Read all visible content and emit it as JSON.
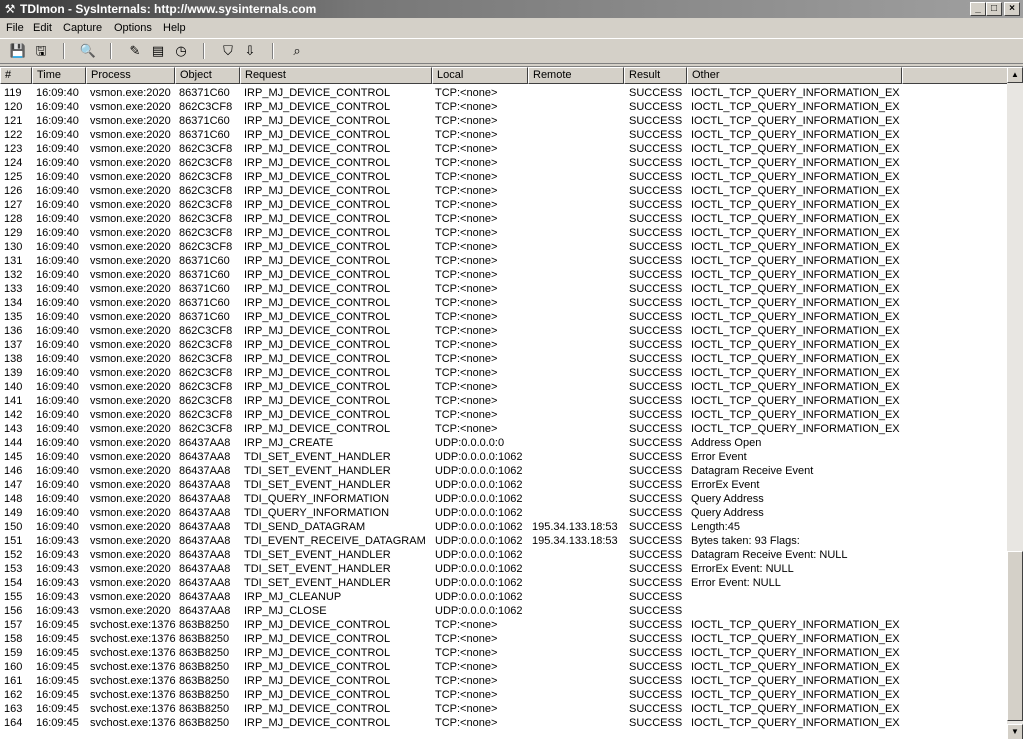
{
  "window": {
    "title": "TDImon - SysInternals: http://www.sysinternals.com",
    "app_icon": "tdimon-icon",
    "minimize": "_",
    "maximize": "□",
    "close": "×"
  },
  "menu": [
    "File",
    "Edit",
    "Capture",
    "Options",
    "Help"
  ],
  "toolbar": {
    "buttons": [
      {
        "name": "save-icon",
        "glyph": "💾"
      },
      {
        "name": "save-as-icon",
        "glyph": "🖫"
      },
      {
        "name": "find-icon",
        "glyph": "🔍"
      },
      {
        "name": "capture-icon",
        "glyph": "✎"
      },
      {
        "name": "autoscroll-icon",
        "glyph": "▤"
      },
      {
        "name": "clock-icon",
        "glyph": "◷"
      },
      {
        "name": "filter-icon",
        "glyph": "⛉"
      },
      {
        "name": "highlight-icon",
        "glyph": "⇩"
      },
      {
        "name": "binoculars-icon",
        "glyph": "⌕"
      }
    ]
  },
  "columns": [
    "#",
    "Time",
    "Process",
    "Object",
    "Request",
    "Local",
    "Remote",
    "Result",
    "Other"
  ],
  "rows": [
    [
      "119",
      "16:09:40",
      "vsmon.exe:2020",
      "86371C60",
      "IRP_MJ_DEVICE_CONTROL",
      "TCP:<none>",
      "",
      "SUCCESS",
      "IOCTL_TCP_QUERY_INFORMATION_EX"
    ],
    [
      "120",
      "16:09:40",
      "vsmon.exe:2020",
      "862C3CF8",
      "IRP_MJ_DEVICE_CONTROL",
      "TCP:<none>",
      "",
      "SUCCESS",
      "IOCTL_TCP_QUERY_INFORMATION_EX"
    ],
    [
      "121",
      "16:09:40",
      "vsmon.exe:2020",
      "86371C60",
      "IRP_MJ_DEVICE_CONTROL",
      "TCP:<none>",
      "",
      "SUCCESS",
      "IOCTL_TCP_QUERY_INFORMATION_EX"
    ],
    [
      "122",
      "16:09:40",
      "vsmon.exe:2020",
      "86371C60",
      "IRP_MJ_DEVICE_CONTROL",
      "TCP:<none>",
      "",
      "SUCCESS",
      "IOCTL_TCP_QUERY_INFORMATION_EX"
    ],
    [
      "123",
      "16:09:40",
      "vsmon.exe:2020",
      "862C3CF8",
      "IRP_MJ_DEVICE_CONTROL",
      "TCP:<none>",
      "",
      "SUCCESS",
      "IOCTL_TCP_QUERY_INFORMATION_EX"
    ],
    [
      "124",
      "16:09:40",
      "vsmon.exe:2020",
      "862C3CF8",
      "IRP_MJ_DEVICE_CONTROL",
      "TCP:<none>",
      "",
      "SUCCESS",
      "IOCTL_TCP_QUERY_INFORMATION_EX"
    ],
    [
      "125",
      "16:09:40",
      "vsmon.exe:2020",
      "862C3CF8",
      "IRP_MJ_DEVICE_CONTROL",
      "TCP:<none>",
      "",
      "SUCCESS",
      "IOCTL_TCP_QUERY_INFORMATION_EX"
    ],
    [
      "126",
      "16:09:40",
      "vsmon.exe:2020",
      "862C3CF8",
      "IRP_MJ_DEVICE_CONTROL",
      "TCP:<none>",
      "",
      "SUCCESS",
      "IOCTL_TCP_QUERY_INFORMATION_EX"
    ],
    [
      "127",
      "16:09:40",
      "vsmon.exe:2020",
      "862C3CF8",
      "IRP_MJ_DEVICE_CONTROL",
      "TCP:<none>",
      "",
      "SUCCESS",
      "IOCTL_TCP_QUERY_INFORMATION_EX"
    ],
    [
      "128",
      "16:09:40",
      "vsmon.exe:2020",
      "862C3CF8",
      "IRP_MJ_DEVICE_CONTROL",
      "TCP:<none>",
      "",
      "SUCCESS",
      "IOCTL_TCP_QUERY_INFORMATION_EX"
    ],
    [
      "129",
      "16:09:40",
      "vsmon.exe:2020",
      "862C3CF8",
      "IRP_MJ_DEVICE_CONTROL",
      "TCP:<none>",
      "",
      "SUCCESS",
      "IOCTL_TCP_QUERY_INFORMATION_EX"
    ],
    [
      "130",
      "16:09:40",
      "vsmon.exe:2020",
      "862C3CF8",
      "IRP_MJ_DEVICE_CONTROL",
      "TCP:<none>",
      "",
      "SUCCESS",
      "IOCTL_TCP_QUERY_INFORMATION_EX"
    ],
    [
      "131",
      "16:09:40",
      "vsmon.exe:2020",
      "86371C60",
      "IRP_MJ_DEVICE_CONTROL",
      "TCP:<none>",
      "",
      "SUCCESS",
      "IOCTL_TCP_QUERY_INFORMATION_EX"
    ],
    [
      "132",
      "16:09:40",
      "vsmon.exe:2020",
      "86371C60",
      "IRP_MJ_DEVICE_CONTROL",
      "TCP:<none>",
      "",
      "SUCCESS",
      "IOCTL_TCP_QUERY_INFORMATION_EX"
    ],
    [
      "133",
      "16:09:40",
      "vsmon.exe:2020",
      "86371C60",
      "IRP_MJ_DEVICE_CONTROL",
      "TCP:<none>",
      "",
      "SUCCESS",
      "IOCTL_TCP_QUERY_INFORMATION_EX"
    ],
    [
      "134",
      "16:09:40",
      "vsmon.exe:2020",
      "86371C60",
      "IRP_MJ_DEVICE_CONTROL",
      "TCP:<none>",
      "",
      "SUCCESS",
      "IOCTL_TCP_QUERY_INFORMATION_EX"
    ],
    [
      "135",
      "16:09:40",
      "vsmon.exe:2020",
      "86371C60",
      "IRP_MJ_DEVICE_CONTROL",
      "TCP:<none>",
      "",
      "SUCCESS",
      "IOCTL_TCP_QUERY_INFORMATION_EX"
    ],
    [
      "136",
      "16:09:40",
      "vsmon.exe:2020",
      "862C3CF8",
      "IRP_MJ_DEVICE_CONTROL",
      "TCP:<none>",
      "",
      "SUCCESS",
      "IOCTL_TCP_QUERY_INFORMATION_EX"
    ],
    [
      "137",
      "16:09:40",
      "vsmon.exe:2020",
      "862C3CF8",
      "IRP_MJ_DEVICE_CONTROL",
      "TCP:<none>",
      "",
      "SUCCESS",
      "IOCTL_TCP_QUERY_INFORMATION_EX"
    ],
    [
      "138",
      "16:09:40",
      "vsmon.exe:2020",
      "862C3CF8",
      "IRP_MJ_DEVICE_CONTROL",
      "TCP:<none>",
      "",
      "SUCCESS",
      "IOCTL_TCP_QUERY_INFORMATION_EX"
    ],
    [
      "139",
      "16:09:40",
      "vsmon.exe:2020",
      "862C3CF8",
      "IRP_MJ_DEVICE_CONTROL",
      "TCP:<none>",
      "",
      "SUCCESS",
      "IOCTL_TCP_QUERY_INFORMATION_EX"
    ],
    [
      "140",
      "16:09:40",
      "vsmon.exe:2020",
      "862C3CF8",
      "IRP_MJ_DEVICE_CONTROL",
      "TCP:<none>",
      "",
      "SUCCESS",
      "IOCTL_TCP_QUERY_INFORMATION_EX"
    ],
    [
      "141",
      "16:09:40",
      "vsmon.exe:2020",
      "862C3CF8",
      "IRP_MJ_DEVICE_CONTROL",
      "TCP:<none>",
      "",
      "SUCCESS",
      "IOCTL_TCP_QUERY_INFORMATION_EX"
    ],
    [
      "142",
      "16:09:40",
      "vsmon.exe:2020",
      "862C3CF8",
      "IRP_MJ_DEVICE_CONTROL",
      "TCP:<none>",
      "",
      "SUCCESS",
      "IOCTL_TCP_QUERY_INFORMATION_EX"
    ],
    [
      "143",
      "16:09:40",
      "vsmon.exe:2020",
      "862C3CF8",
      "IRP_MJ_DEVICE_CONTROL",
      "TCP:<none>",
      "",
      "SUCCESS",
      "IOCTL_TCP_QUERY_INFORMATION_EX"
    ],
    [
      "144",
      "16:09:40",
      "vsmon.exe:2020",
      "86437AA8",
      "IRP_MJ_CREATE",
      "UDP:0.0.0.0:0",
      "",
      "SUCCESS",
      "Address Open"
    ],
    [
      "145",
      "16:09:40",
      "vsmon.exe:2020",
      "86437AA8",
      "TDI_SET_EVENT_HANDLER",
      "UDP:0.0.0.0:1062",
      "",
      "SUCCESS",
      "Error Event"
    ],
    [
      "146",
      "16:09:40",
      "vsmon.exe:2020",
      "86437AA8",
      "TDI_SET_EVENT_HANDLER",
      "UDP:0.0.0.0:1062",
      "",
      "SUCCESS",
      "Datagram Receive Event"
    ],
    [
      "147",
      "16:09:40",
      "vsmon.exe:2020",
      "86437AA8",
      "TDI_SET_EVENT_HANDLER",
      "UDP:0.0.0.0:1062",
      "",
      "SUCCESS",
      "ErrorEx Event"
    ],
    [
      "148",
      "16:09:40",
      "vsmon.exe:2020",
      "86437AA8",
      "TDI_QUERY_INFORMATION",
      "UDP:0.0.0.0:1062",
      "",
      "SUCCESS",
      "Query Address"
    ],
    [
      "149",
      "16:09:40",
      "vsmon.exe:2020",
      "86437AA8",
      "TDI_QUERY_INFORMATION",
      "UDP:0.0.0.0:1062",
      "",
      "SUCCESS",
      "Query Address"
    ],
    [
      "150",
      "16:09:40",
      "vsmon.exe:2020",
      "86437AA8",
      "TDI_SEND_DATAGRAM",
      "UDP:0.0.0.0:1062",
      "195.34.133.18:53",
      "SUCCESS",
      "Length:45"
    ],
    [
      "151",
      "16:09:43",
      "vsmon.exe:2020",
      "86437AA8",
      "TDI_EVENT_RECEIVE_DATAGRAM",
      "UDP:0.0.0.0:1062",
      "195.34.133.18:53",
      "SUCCESS",
      "Bytes taken: 93 Flags:"
    ],
    [
      "152",
      "16:09:43",
      "vsmon.exe:2020",
      "86437AA8",
      "TDI_SET_EVENT_HANDLER",
      "UDP:0.0.0.0:1062",
      "",
      "SUCCESS",
      "Datagram Receive Event: NULL"
    ],
    [
      "153",
      "16:09:43",
      "vsmon.exe:2020",
      "86437AA8",
      "TDI_SET_EVENT_HANDLER",
      "UDP:0.0.0.0:1062",
      "",
      "SUCCESS",
      "ErrorEx Event: NULL"
    ],
    [
      "154",
      "16:09:43",
      "vsmon.exe:2020",
      "86437AA8",
      "TDI_SET_EVENT_HANDLER",
      "UDP:0.0.0.0:1062",
      "",
      "SUCCESS",
      "Error Event: NULL"
    ],
    [
      "155",
      "16:09:43",
      "vsmon.exe:2020",
      "86437AA8",
      "IRP_MJ_CLEANUP",
      "UDP:0.0.0.0:1062",
      "",
      "SUCCESS",
      ""
    ],
    [
      "156",
      "16:09:43",
      "vsmon.exe:2020",
      "86437AA8",
      "IRP_MJ_CLOSE",
      "UDP:0.0.0.0:1062",
      "",
      "SUCCESS",
      ""
    ],
    [
      "157",
      "16:09:45",
      "svchost.exe:1376",
      "863B8250",
      "IRP_MJ_DEVICE_CONTROL",
      "TCP:<none>",
      "",
      "SUCCESS",
      "IOCTL_TCP_QUERY_INFORMATION_EX"
    ],
    [
      "158",
      "16:09:45",
      "svchost.exe:1376",
      "863B8250",
      "IRP_MJ_DEVICE_CONTROL",
      "TCP:<none>",
      "",
      "SUCCESS",
      "IOCTL_TCP_QUERY_INFORMATION_EX"
    ],
    [
      "159",
      "16:09:45",
      "svchost.exe:1376",
      "863B8250",
      "IRP_MJ_DEVICE_CONTROL",
      "TCP:<none>",
      "",
      "SUCCESS",
      "IOCTL_TCP_QUERY_INFORMATION_EX"
    ],
    [
      "160",
      "16:09:45",
      "svchost.exe:1376",
      "863B8250",
      "IRP_MJ_DEVICE_CONTROL",
      "TCP:<none>",
      "",
      "SUCCESS",
      "IOCTL_TCP_QUERY_INFORMATION_EX"
    ],
    [
      "161",
      "16:09:45",
      "svchost.exe:1376",
      "863B8250",
      "IRP_MJ_DEVICE_CONTROL",
      "TCP:<none>",
      "",
      "SUCCESS",
      "IOCTL_TCP_QUERY_INFORMATION_EX"
    ],
    [
      "162",
      "16:09:45",
      "svchost.exe:1376",
      "863B8250",
      "IRP_MJ_DEVICE_CONTROL",
      "TCP:<none>",
      "",
      "SUCCESS",
      "IOCTL_TCP_QUERY_INFORMATION_EX"
    ],
    [
      "163",
      "16:09:45",
      "svchost.exe:1376",
      "863B8250",
      "IRP_MJ_DEVICE_CONTROL",
      "TCP:<none>",
      "",
      "SUCCESS",
      "IOCTL_TCP_QUERY_INFORMATION_EX"
    ],
    [
      "164",
      "16:09:45",
      "svchost.exe:1376",
      "863B8250",
      "IRP_MJ_DEVICE_CONTROL",
      "TCP:<none>",
      "",
      "SUCCESS",
      "IOCTL_TCP_QUERY_INFORMATION_EX"
    ]
  ],
  "scrollbar": {
    "up": "▲",
    "down": "▼"
  },
  "colors": {
    "window_bg": "#d4d0c8",
    "list_bg": "#ffffff",
    "title_gradient_start": "#3a3a3a"
  }
}
